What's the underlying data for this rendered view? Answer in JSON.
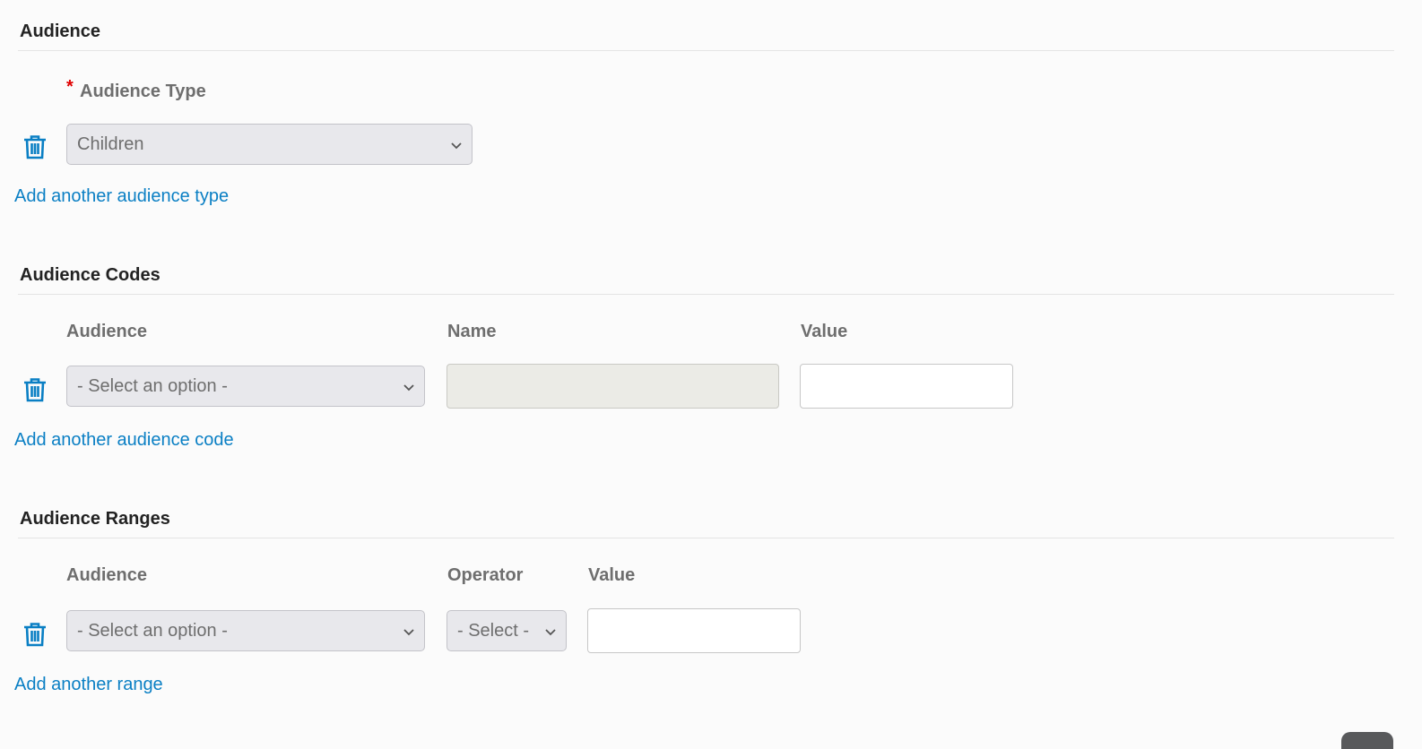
{
  "audience": {
    "title": "Audience",
    "type_label": "Audience Type",
    "required_mark": "*",
    "selected_value": "Children",
    "add_link": "Add another audience type"
  },
  "codes": {
    "title": "Audience Codes",
    "columns": {
      "audience": "Audience",
      "name": "Name",
      "value": "Value"
    },
    "audience_select": "- Select an option -",
    "name_value": "",
    "value_value": "",
    "add_link": "Add another audience code"
  },
  "ranges": {
    "title": "Audience Ranges",
    "columns": {
      "audience": "Audience",
      "operator": "Operator",
      "value": "Value"
    },
    "audience_select": "- Select an option -",
    "operator_select": "- Select -",
    "value_value": "",
    "add_link": "Add another range"
  },
  "colors": {
    "link": "#0a7fc4",
    "icon": "#0a7fc4",
    "required": "#e00000"
  },
  "icons": [
    "trash-icon",
    "chevron-down-icon"
  ]
}
